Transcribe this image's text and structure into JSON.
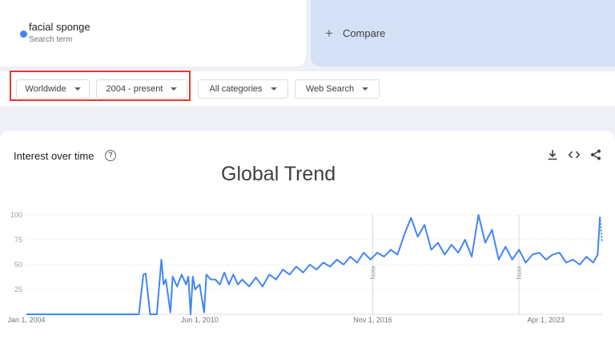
{
  "search_term": {
    "name": "facial sponge",
    "subtitle": "Search term",
    "color": "#4285f4"
  },
  "compare": {
    "plus": "+",
    "label": "Compare"
  },
  "filters": [
    {
      "label": "Worldwide"
    },
    {
      "label": "2004 - present"
    },
    {
      "label": "All categories"
    },
    {
      "label": "Web Search"
    }
  ],
  "panel": {
    "title": "Interest over time",
    "help_glyph": "?",
    "overlay_title": "Global Trend"
  },
  "tools": [
    "download-icon",
    "embed-icon",
    "share-icon"
  ],
  "chart_data": {
    "type": "line",
    "series": [
      {
        "color": "#4285f4",
        "points": [
          [
            "2004-01",
            0
          ],
          [
            "2005-06",
            0
          ],
          [
            "2007-06",
            0
          ],
          [
            "2008-03",
            0
          ],
          [
            "2008-05",
            40
          ],
          [
            "2008-06",
            41
          ],
          [
            "2008-08",
            0
          ],
          [
            "2008-11",
            0
          ],
          [
            "2009-01",
            55
          ],
          [
            "2009-02",
            30
          ],
          [
            "2009-03",
            35
          ],
          [
            "2009-05",
            2
          ],
          [
            "2009-06",
            38
          ],
          [
            "2009-08",
            28
          ],
          [
            "2009-10",
            40
          ],
          [
            "2009-12",
            30
          ],
          [
            "2010-01",
            38
          ],
          [
            "2010-02",
            0
          ],
          [
            "2010-03",
            38
          ],
          [
            "2010-04",
            25
          ],
          [
            "2010-06",
            30
          ],
          [
            "2010-08",
            2
          ],
          [
            "2010-09",
            40
          ],
          [
            "2010-11",
            35
          ],
          [
            "2011-01",
            35
          ],
          [
            "2011-03",
            30
          ],
          [
            "2011-05",
            42
          ],
          [
            "2011-07",
            30
          ],
          [
            "2011-09",
            40
          ],
          [
            "2011-11",
            30
          ],
          [
            "2012-01",
            35
          ],
          [
            "2012-04",
            28
          ],
          [
            "2012-07",
            37
          ],
          [
            "2012-10",
            28
          ],
          [
            "2013-01",
            40
          ],
          [
            "2013-04",
            35
          ],
          [
            "2013-07",
            45
          ],
          [
            "2013-10",
            40
          ],
          [
            "2014-01",
            48
          ],
          [
            "2014-04",
            42
          ],
          [
            "2014-07",
            50
          ],
          [
            "2014-10",
            45
          ],
          [
            "2015-01",
            52
          ],
          [
            "2015-04",
            48
          ],
          [
            "2015-07",
            55
          ],
          [
            "2015-10",
            50
          ],
          [
            "2016-01",
            58
          ],
          [
            "2016-04",
            52
          ],
          [
            "2016-07",
            62
          ],
          [
            "2016-10",
            55
          ],
          [
            "2017-01",
            62
          ],
          [
            "2017-04",
            58
          ],
          [
            "2017-07",
            65
          ],
          [
            "2017-10",
            60
          ],
          [
            "2018-01",
            80
          ],
          [
            "2018-04",
            97
          ],
          [
            "2018-07",
            78
          ],
          [
            "2018-10",
            90
          ],
          [
            "2019-01",
            65
          ],
          [
            "2019-04",
            72
          ],
          [
            "2019-07",
            60
          ],
          [
            "2019-10",
            70
          ],
          [
            "2020-01",
            62
          ],
          [
            "2020-04",
            75
          ],
          [
            "2020-07",
            58
          ],
          [
            "2020-10",
            100
          ],
          [
            "2021-01",
            72
          ],
          [
            "2021-04",
            85
          ],
          [
            "2021-07",
            55
          ],
          [
            "2021-10",
            68
          ],
          [
            "2022-01",
            55
          ],
          [
            "2022-04",
            65
          ],
          [
            "2022-07",
            52
          ],
          [
            "2022-10",
            60
          ],
          [
            "2023-01",
            62
          ],
          [
            "2023-04",
            55
          ],
          [
            "2023-07",
            60
          ],
          [
            "2023-10",
            62
          ],
          [
            "2024-01",
            52
          ],
          [
            "2024-04",
            55
          ],
          [
            "2024-07",
            50
          ],
          [
            "2024-10",
            58
          ],
          [
            "2025-01",
            52
          ],
          [
            "2025-03",
            60
          ],
          [
            "2025-04",
            98
          ]
        ]
      }
    ],
    "partial_points": [
      [
        "2025-04",
        98
      ],
      [
        "2025-05",
        72
      ]
    ],
    "x_ticks": [
      "Jan 1, 2004",
      "Jun 1, 2010",
      "Nov 1, 2016",
      "Apr 1, 2023"
    ],
    "y_ticks": [
      25,
      50,
      75,
      100
    ],
    "annotations": [
      {
        "x": "2016-11",
        "text": "Note"
      },
      {
        "x": "2022-04",
        "text": "Note"
      }
    ],
    "xlim": [
      "2004-01",
      "2025-05"
    ],
    "ylim": [
      0,
      100
    ],
    "grid": true
  }
}
